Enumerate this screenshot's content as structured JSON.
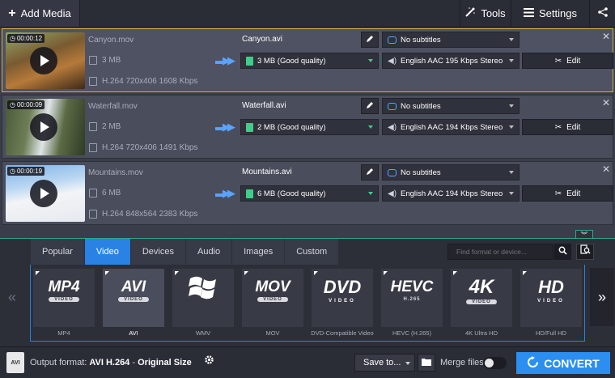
{
  "toolbar": {
    "add_media": "Add Media",
    "tools": "Tools",
    "settings": "Settings"
  },
  "files": [
    {
      "duration": "00:00:12",
      "source_name": "Canyon.mov",
      "source_size": "3 MB",
      "source_codec": "H.264 720x406 1608 Kbps",
      "output_name": "Canyon.avi",
      "output_size": "3 MB (Good quality)",
      "subtitles": "No subtitles",
      "audio": "English AAC 195 Kbps Stereo",
      "edit_label": "Edit"
    },
    {
      "duration": "00:00:09",
      "source_name": "Waterfall.mov",
      "source_size": "2 MB",
      "source_codec": "H.264 720x406 1491 Kbps",
      "output_name": "Waterfall.avi",
      "output_size": "2 MB (Good quality)",
      "subtitles": "No subtitles",
      "audio": "English AAC 194 Kbps Stereo",
      "edit_label": "Edit"
    },
    {
      "duration": "00:00:19",
      "source_name": "Mountains.mov",
      "source_size": "6 MB",
      "source_codec": "H.264 848x564 2383 Kbps",
      "output_name": "Mountains.avi",
      "output_size": "6 MB (Good quality)",
      "subtitles": "No subtitles",
      "audio": "English AAC 194 Kbps Stereo",
      "edit_label": "Edit"
    }
  ],
  "format_tabs": [
    "Popular",
    "Video",
    "Devices",
    "Audio",
    "Images",
    "Custom"
  ],
  "active_tab": "Video",
  "search": {
    "placeholder": "Find format or device..."
  },
  "formats": [
    {
      "logo": "MP4",
      "tag": "VIDEO",
      "caption": "MP4"
    },
    {
      "logo": "AVI",
      "tag": "VIDEO",
      "caption": "AVI"
    },
    {
      "logo": "",
      "tag": "",
      "caption": "WMV"
    },
    {
      "logo": "MOV",
      "tag": "VIDEO",
      "caption": "MOV"
    },
    {
      "logo": "DVD",
      "tag": "VIDEO",
      "caption": "DVD-Compatible Video"
    },
    {
      "logo": "HEVC",
      "tag": "H.265",
      "caption": "HEVC (H.265)"
    },
    {
      "logo": "4K",
      "tag": "VIDEO",
      "caption": "4K Ultra HD"
    },
    {
      "logo": "HD",
      "tag": "VIDEO",
      "caption": "HD/Full HD"
    }
  ],
  "bottom": {
    "output_icon_text": "AVI",
    "output_prefix": "Output format:",
    "output_format": "AVI H.264",
    "output_sep": "-",
    "output_size": "Original Size",
    "save_to": "Save to...",
    "merge_files": "Merge files:",
    "convert": "CONVERT"
  },
  "colors": {
    "accent": "#2a82e4",
    "convert": "#2a8ff0",
    "selected_border": "#d4b04a",
    "teal_line": "#2ca88a"
  }
}
